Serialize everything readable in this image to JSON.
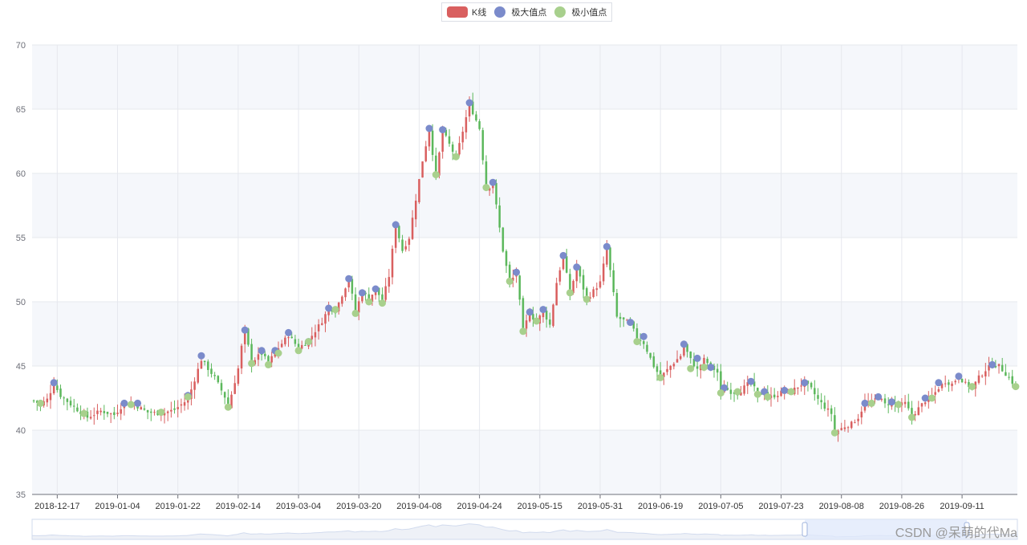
{
  "colors": {
    "up": "#d95f5f",
    "down": "#5cb85c",
    "max_point": "#7b8bcb",
    "min_point": "#a8d08d",
    "band": "#f5f7fb",
    "grid": "#e6e8ee",
    "zoom_fill": "#dfe8fb"
  },
  "legend": {
    "kline_label": "K线",
    "max_label": "极大值点",
    "min_label": "极小值点"
  },
  "watermark": "CSDN @呆萌的代Ma",
  "chart_data": {
    "type": "candlestick",
    "title": "",
    "xlabel": "",
    "ylabel": "",
    "ylim": [
      35,
      70
    ],
    "y_ticks": [
      35,
      40,
      45,
      50,
      55,
      60,
      65,
      70
    ],
    "x_tick_labels": [
      "2018-12-17",
      "2019-01-04",
      "2019-01-22",
      "2019-02-14",
      "2019-03-04",
      "2019-03-20",
      "2019-04-08",
      "2019-04-24",
      "2019-05-15",
      "2019-05-31",
      "2019-06-19",
      "2019-07-05",
      "2019-07-23",
      "2019-08-08",
      "2019-08-26",
      "2019-09-11"
    ],
    "x_tick_index": [
      7,
      25,
      43,
      61,
      79,
      97,
      115,
      133,
      151,
      169,
      187,
      205,
      223,
      241,
      259,
      277
    ],
    "n_days": 294,
    "legend_position": "top-center",
    "grid": true,
    "anchors": [
      [
        0,
        42.3
      ],
      [
        2,
        42.0
      ],
      [
        4,
        42.4
      ],
      [
        6,
        43.6
      ],
      [
        8,
        42.7
      ],
      [
        12,
        41.8
      ],
      [
        16,
        41.0
      ],
      [
        20,
        41.5
      ],
      [
        24,
        41.2
      ],
      [
        27,
        42.1
      ],
      [
        30,
        42.0
      ],
      [
        34,
        41.4
      ],
      [
        38,
        41.3
      ],
      [
        42,
        41.6
      ],
      [
        46,
        42.4
      ],
      [
        50,
        45.5
      ],
      [
        54,
        44.1
      ],
      [
        57,
        42.6
      ],
      [
        58,
        41.8
      ],
      [
        61,
        44.8
      ],
      [
        62,
        46.5
      ],
      [
        63,
        47.8
      ],
      [
        65,
        45.3
      ],
      [
        68,
        46.0
      ],
      [
        70,
        45.2
      ],
      [
        72,
        46.1
      ],
      [
        76,
        47.4
      ],
      [
        79,
        46.4
      ],
      [
        82,
        47.0
      ],
      [
        86,
        48.5
      ],
      [
        88,
        49.5
      ],
      [
        90,
        49.3
      ],
      [
        94,
        51.8
      ],
      [
        96,
        49.2
      ],
      [
        98,
        50.8
      ],
      [
        100,
        50.2
      ],
      [
        102,
        51.0
      ],
      [
        104,
        50.1
      ],
      [
        106,
        52.0
      ],
      [
        108,
        56.0
      ],
      [
        110,
        54.0
      ],
      [
        112,
        55.0
      ],
      [
        116,
        61.0
      ],
      [
        118,
        63.4
      ],
      [
        120,
        59.8
      ],
      [
        122,
        63.3
      ],
      [
        126,
        61.2
      ],
      [
        130,
        65.4
      ],
      [
        133,
        63.5
      ],
      [
        135,
        58.8
      ],
      [
        137,
        59.2
      ],
      [
        140,
        54.0
      ],
      [
        142,
        51.5
      ],
      [
        144,
        52.2
      ],
      [
        146,
        47.8
      ],
      [
        148,
        49.1
      ],
      [
        150,
        48.4
      ],
      [
        152,
        49.3
      ],
      [
        154,
        48.2
      ],
      [
        156,
        51.5
      ],
      [
        158,
        53.6
      ],
      [
        160,
        50.6
      ],
      [
        162,
        52.7
      ],
      [
        165,
        50.2
      ],
      [
        169,
        51.5
      ],
      [
        171,
        54.2
      ],
      [
        174,
        48.8
      ],
      [
        178,
        48.3
      ],
      [
        180,
        47.2
      ],
      [
        182,
        46.8
      ],
      [
        185,
        45.0
      ],
      [
        187,
        44.1
      ],
      [
        190,
        45.0
      ],
      [
        193,
        45.8
      ],
      [
        194,
        46.6
      ],
      [
        196,
        45.5
      ],
      [
        198,
        44.7
      ],
      [
        200,
        45.5
      ],
      [
        202,
        45.0
      ],
      [
        204,
        44.5
      ],
      [
        205,
        42.8
      ],
      [
        206,
        43.3
      ],
      [
        208,
        43.0
      ],
      [
        210,
        42.9
      ],
      [
        214,
        43.8
      ],
      [
        216,
        42.7
      ],
      [
        218,
        43.0
      ],
      [
        219,
        42.5
      ],
      [
        222,
        42.8
      ],
      [
        224,
        43.1
      ],
      [
        226,
        43.0
      ],
      [
        228,
        43.4
      ],
      [
        230,
        43.7
      ],
      [
        232,
        43.2
      ],
      [
        234,
        42.4
      ],
      [
        236,
        41.8
      ],
      [
        238,
        41.3
      ],
      [
        239,
        39.8
      ],
      [
        242,
        40.3
      ],
      [
        244,
        40.5
      ],
      [
        246,
        41.0
      ],
      [
        248,
        42.1
      ],
      [
        250,
        42.2
      ],
      [
        252,
        42.6
      ],
      [
        254,
        42.0
      ],
      [
        256,
        42.2
      ],
      [
        258,
        41.9
      ],
      [
        260,
        42.1
      ],
      [
        262,
        41.1
      ],
      [
        264,
        41.7
      ],
      [
        266,
        42.3
      ],
      [
        268,
        42.6
      ],
      [
        270,
        43.3
      ],
      [
        272,
        43.8
      ],
      [
        274,
        43.6
      ],
      [
        276,
        44.2
      ],
      [
        278,
        43.6
      ],
      [
        280,
        43.3
      ],
      [
        282,
        44.1
      ],
      [
        284,
        44.7
      ],
      [
        286,
        45.1
      ],
      [
        288,
        45.0
      ],
      [
        290,
        44.4
      ],
      [
        293,
        43.4
      ]
    ],
    "max_points": [
      [
        6,
        43.7
      ],
      [
        27,
        42.1
      ],
      [
        31,
        42.1
      ],
      [
        46,
        42.7
      ],
      [
        50,
        45.8
      ],
      [
        63,
        47.8
      ],
      [
        68,
        46.2
      ],
      [
        72,
        46.2
      ],
      [
        76,
        47.6
      ],
      [
        82,
        46.9
      ],
      [
        88,
        49.5
      ],
      [
        94,
        51.8
      ],
      [
        98,
        50.7
      ],
      [
        102,
        51.0
      ],
      [
        108,
        56.0
      ],
      [
        118,
        63.5
      ],
      [
        122,
        63.4
      ],
      [
        130,
        65.5
      ],
      [
        137,
        59.3
      ],
      [
        144,
        52.3
      ],
      [
        148,
        49.2
      ],
      [
        152,
        49.4
      ],
      [
        158,
        53.6
      ],
      [
        162,
        52.7
      ],
      [
        171,
        54.3
      ],
      [
        178,
        48.4
      ],
      [
        182,
        47.3
      ],
      [
        194,
        46.7
      ],
      [
        198,
        45.6
      ],
      [
        202,
        44.9
      ],
      [
        206,
        43.3
      ],
      [
        214,
        43.8
      ],
      [
        218,
        43.0
      ],
      [
        224,
        43.1
      ],
      [
        230,
        43.7
      ],
      [
        248,
        42.1
      ],
      [
        252,
        42.6
      ],
      [
        256,
        42.2
      ],
      [
        266,
        42.5
      ],
      [
        270,
        43.7
      ],
      [
        276,
        44.2
      ],
      [
        286,
        45.1
      ]
    ],
    "min_points": [
      [
        2,
        42.1
      ],
      [
        15,
        41.3
      ],
      [
        29,
        42.0
      ],
      [
        38,
        41.4
      ],
      [
        46,
        42.6
      ],
      [
        58,
        41.8
      ],
      [
        65,
        45.2
      ],
      [
        70,
        45.1
      ],
      [
        73,
        46.0
      ],
      [
        79,
        46.2
      ],
      [
        82,
        46.9
      ],
      [
        90,
        49.4
      ],
      [
        96,
        49.1
      ],
      [
        100,
        50.0
      ],
      [
        104,
        49.9
      ],
      [
        120,
        59.9
      ],
      [
        126,
        61.3
      ],
      [
        135,
        58.9
      ],
      [
        142,
        51.6
      ],
      [
        146,
        47.7
      ],
      [
        150,
        48.5
      ],
      [
        160,
        50.7
      ],
      [
        165,
        50.2
      ],
      [
        180,
        46.9
      ],
      [
        187,
        44.1
      ],
      [
        196,
        44.8
      ],
      [
        200,
        44.9
      ],
      [
        205,
        42.9
      ],
      [
        210,
        43.0
      ],
      [
        216,
        42.8
      ],
      [
        219,
        42.6
      ],
      [
        226,
        43.0
      ],
      [
        239,
        39.8
      ],
      [
        250,
        42.1
      ],
      [
        258,
        42.0
      ],
      [
        262,
        41.0
      ],
      [
        268,
        42.5
      ],
      [
        280,
        43.4
      ],
      [
        293,
        43.4
      ]
    ]
  }
}
